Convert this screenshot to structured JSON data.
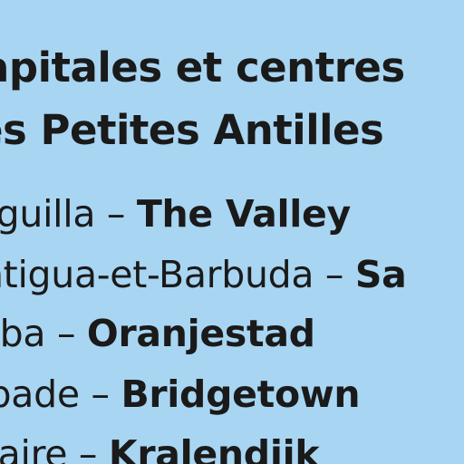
{
  "legend": {
    "title_line_1": "apitales et centres",
    "title_line_2": "es Petites Antilles",
    "entries": [
      {
        "territory": "nguilla",
        "separator": " – ",
        "capital": "The Valley"
      },
      {
        "territory": "ntigua-et-Barbuda",
        "separator": " – ",
        "capital": "Sa"
      },
      {
        "territory": "uba",
        "separator": " – ",
        "capital": "Oranjestad"
      },
      {
        "territory": "rbade",
        "separator": " – ",
        "capital": "Bridgetown"
      },
      {
        "territory": "naire",
        "separator": " – ",
        "capital": "Kralendijk"
      }
    ]
  },
  "colors": {
    "background": "#a8d5f2",
    "text": "#1a1a1a"
  }
}
